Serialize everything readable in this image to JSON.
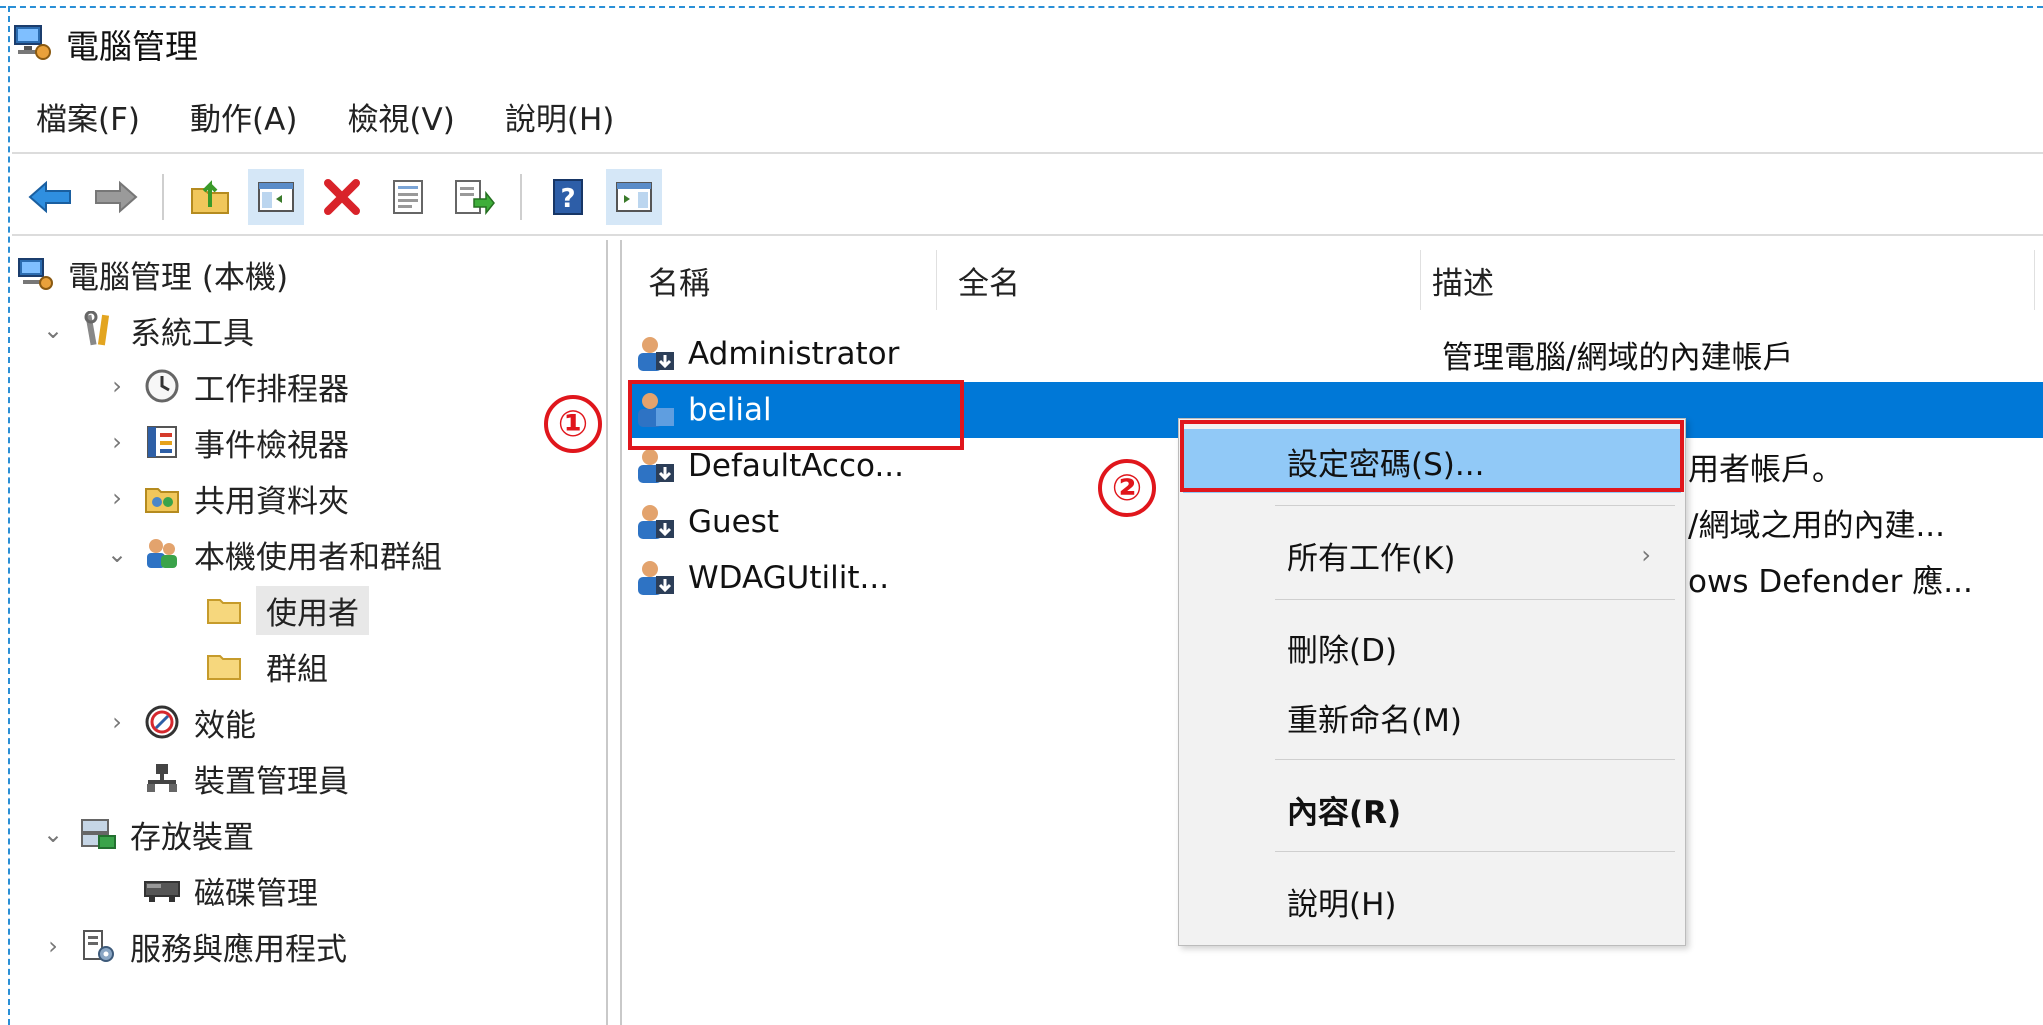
{
  "window": {
    "title": "電腦管理"
  },
  "menubar": [
    "檔案(F)",
    "動作(A)",
    "檢視(V)",
    "說明(H)"
  ],
  "toolbar": {
    "icons": [
      "back-arrow-icon",
      "forward-arrow-icon",
      "up-folder-icon",
      "show-hide-console-tree-icon",
      "delete-icon",
      "properties-icon",
      "export-list-icon",
      "help-icon",
      "show-hide-action-pane-icon"
    ]
  },
  "tree": {
    "root": "電腦管理 (本機)",
    "system_tools": "系統工具",
    "task_scheduler": "工作排程器",
    "event_viewer": "事件檢視器",
    "shared_folders": "共用資料夾",
    "local_users_groups": "本機使用者和群組",
    "users": "使用者",
    "groups": "群組",
    "performance": "效能",
    "device_manager": "裝置管理員",
    "storage": "存放裝置",
    "disk_management": "磁碟管理",
    "services_apps": "服務與應用程式"
  },
  "list": {
    "columns": [
      "名稱",
      "全名",
      "描述"
    ],
    "rows": [
      {
        "name": "Administrator",
        "full_name": "",
        "description": "管理電腦/網域的內建帳戶"
      },
      {
        "name": "belial",
        "full_name": "",
        "description": ""
      },
      {
        "name": "DefaultAcco...",
        "full_name": "",
        "description": "用者帳戶。"
      },
      {
        "name": "Guest",
        "full_name": "",
        "description": "/網域之用的內建..."
      },
      {
        "name": "WDAGUtilit...",
        "full_name": "",
        "description": "ows Defender 應..."
      }
    ],
    "selected_index": 1
  },
  "context_menu": {
    "set_password": "設定密碼(S)...",
    "all_tasks": "所有工作(K)",
    "all_tasks_arrow": "›",
    "delete": "刪除(D)",
    "rename": "重新命名(M)",
    "properties": "內容(R)",
    "help": "說明(H)"
  },
  "annotations": {
    "step1": "①",
    "step2": "②",
    "color": "#e0161c"
  },
  "colors": {
    "selection": "#0078d7",
    "menu_highlight": "#91c9f7",
    "dashed_border": "#2a8fd6"
  }
}
